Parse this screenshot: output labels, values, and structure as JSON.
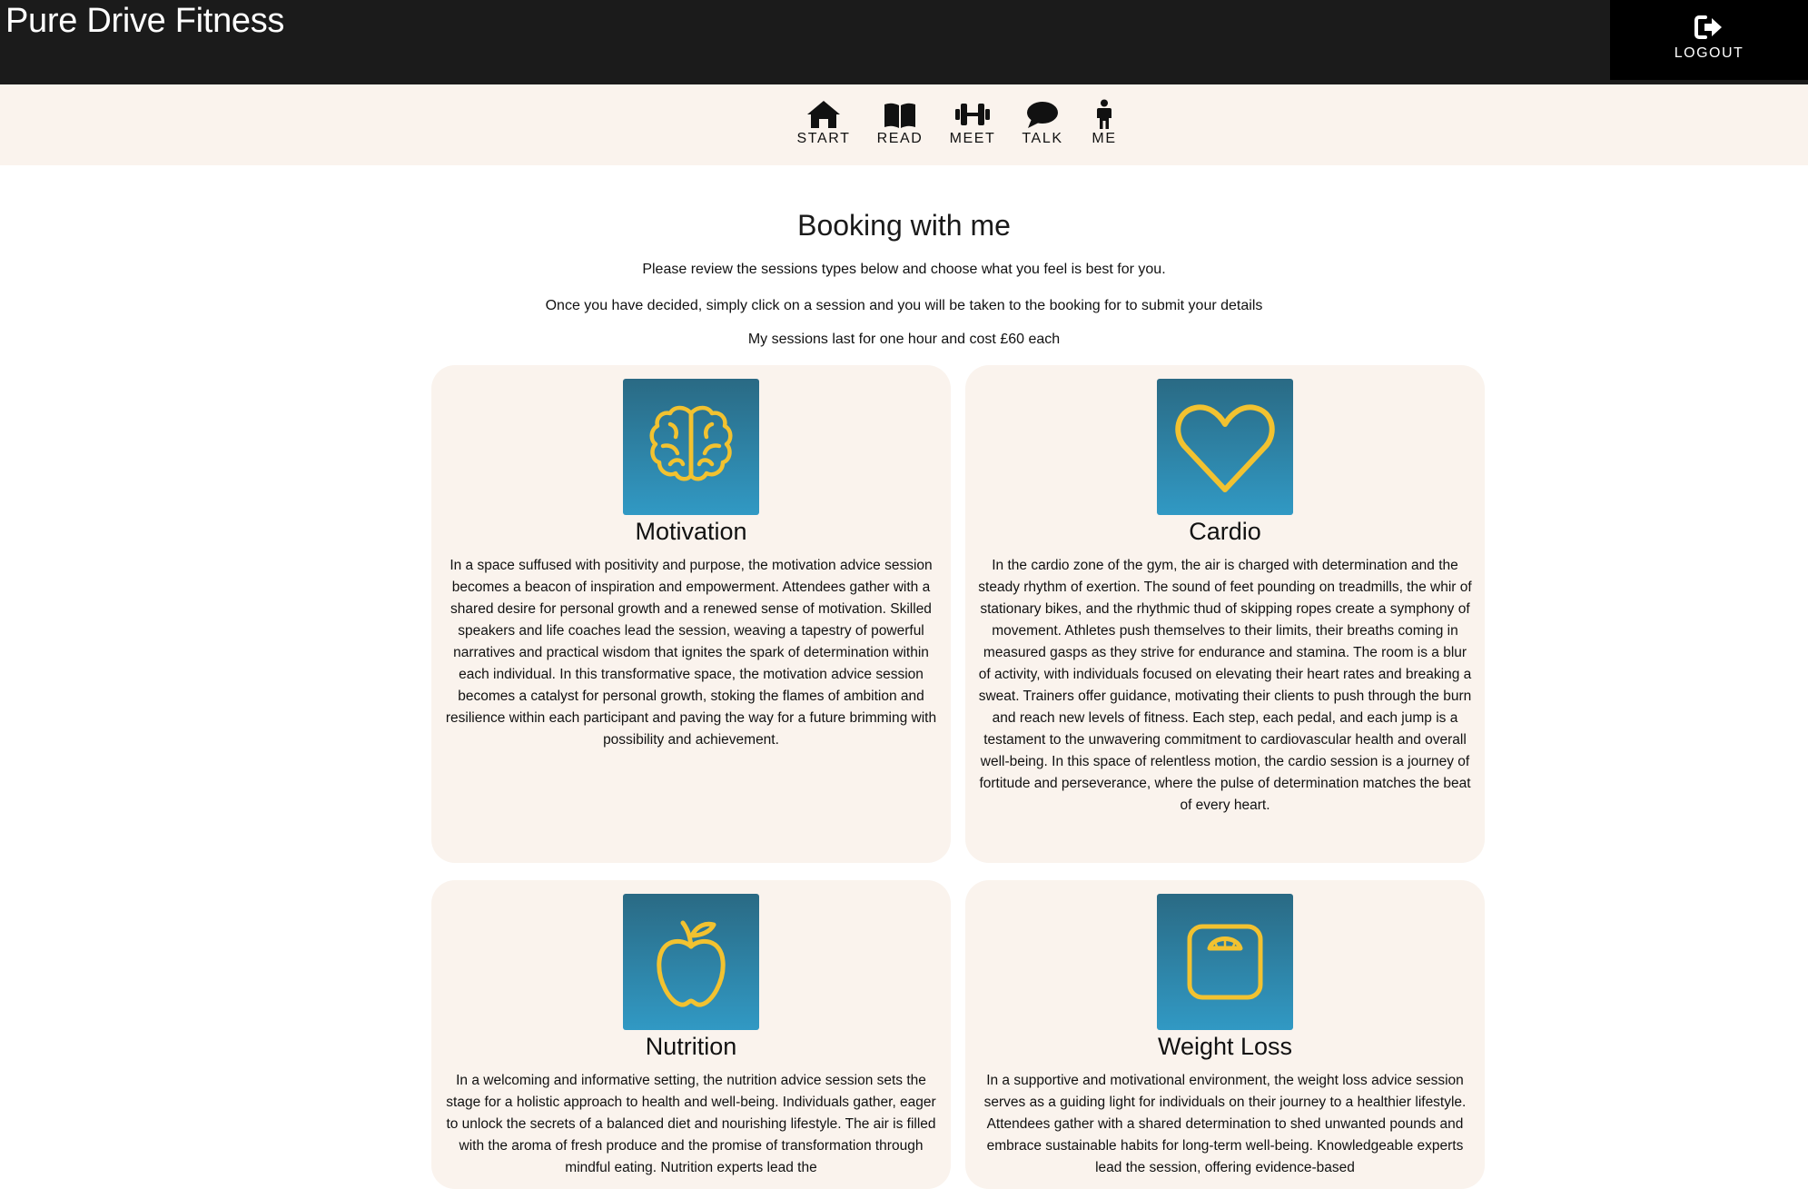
{
  "header": {
    "brand": "Pure Drive Fitness",
    "logout_label": "LOGOUT"
  },
  "nav": {
    "items": [
      {
        "label": "START",
        "icon": "home-icon"
      },
      {
        "label": "READ",
        "icon": "book-icon"
      },
      {
        "label": "MEET",
        "icon": "dumbbell-icon"
      },
      {
        "label": "TALK",
        "icon": "speech-bubble-icon"
      },
      {
        "label": "ME",
        "icon": "person-icon"
      }
    ]
  },
  "main": {
    "title": "Booking with me",
    "intro": [
      "Please review the sessions types below and choose what you feel is best for you.",
      "Once you have decided, simply click on a session and you will be taken to the booking for to submit your details",
      "My sessions last for one hour and cost £60 each"
    ],
    "sessions": [
      {
        "title": "Motivation",
        "icon": "brain-icon",
        "text": "In a space suffused with positivity and purpose, the motivation advice session becomes a beacon of inspiration and empowerment. Attendees gather with a shared desire for personal growth and a renewed sense of motivation. Skilled speakers and life coaches lead the session, weaving a tapestry of powerful narratives and practical wisdom that ignites the spark of determination within each individual. In this transformative space, the motivation advice session becomes a catalyst for personal growth, stoking the flames of ambition and resilience within each participant and paving the way for a future brimming with possibility and achievement."
      },
      {
        "title": "Cardio",
        "icon": "heart-icon",
        "text": "In the cardio zone of the gym, the air is charged with determination and the steady rhythm of exertion. The sound of feet pounding on treadmills, the whir of stationary bikes, and the rhythmic thud of skipping ropes create a symphony of movement. Athletes push themselves to their limits, their breaths coming in measured gasps as they strive for endurance and stamina. The room is a blur of activity, with individuals focused on elevating their heart rates and breaking a sweat. Trainers offer guidance, motivating their clients to push through the burn and reach new levels of fitness. Each step, each pedal, and each jump is a testament to the unwavering commitment to cardiovascular health and overall well-being. In this space of relentless motion, the cardio session is a journey of fortitude and perseverance, where the pulse of determination matches the beat of every heart."
      },
      {
        "title": "Nutrition",
        "icon": "apple-icon",
        "text": "In a welcoming and informative setting, the nutrition advice session sets the stage for a holistic approach to health and well-being. Individuals gather, eager to unlock the secrets of a balanced diet and nourishing lifestyle. The air is filled with the aroma of fresh produce and the promise of transformation through mindful eating. Nutrition experts lead the"
      },
      {
        "title": "Weight Loss",
        "icon": "scale-icon",
        "text": "In a supportive and motivational environment, the weight loss advice session serves as a guiding light for individuals on their journey to a healthier lifestyle. Attendees gather with a shared determination to shed unwanted pounds and embrace sustainable habits for long-term well-being. Knowledgeable experts lead the session, offering evidence-based"
      }
    ]
  }
}
